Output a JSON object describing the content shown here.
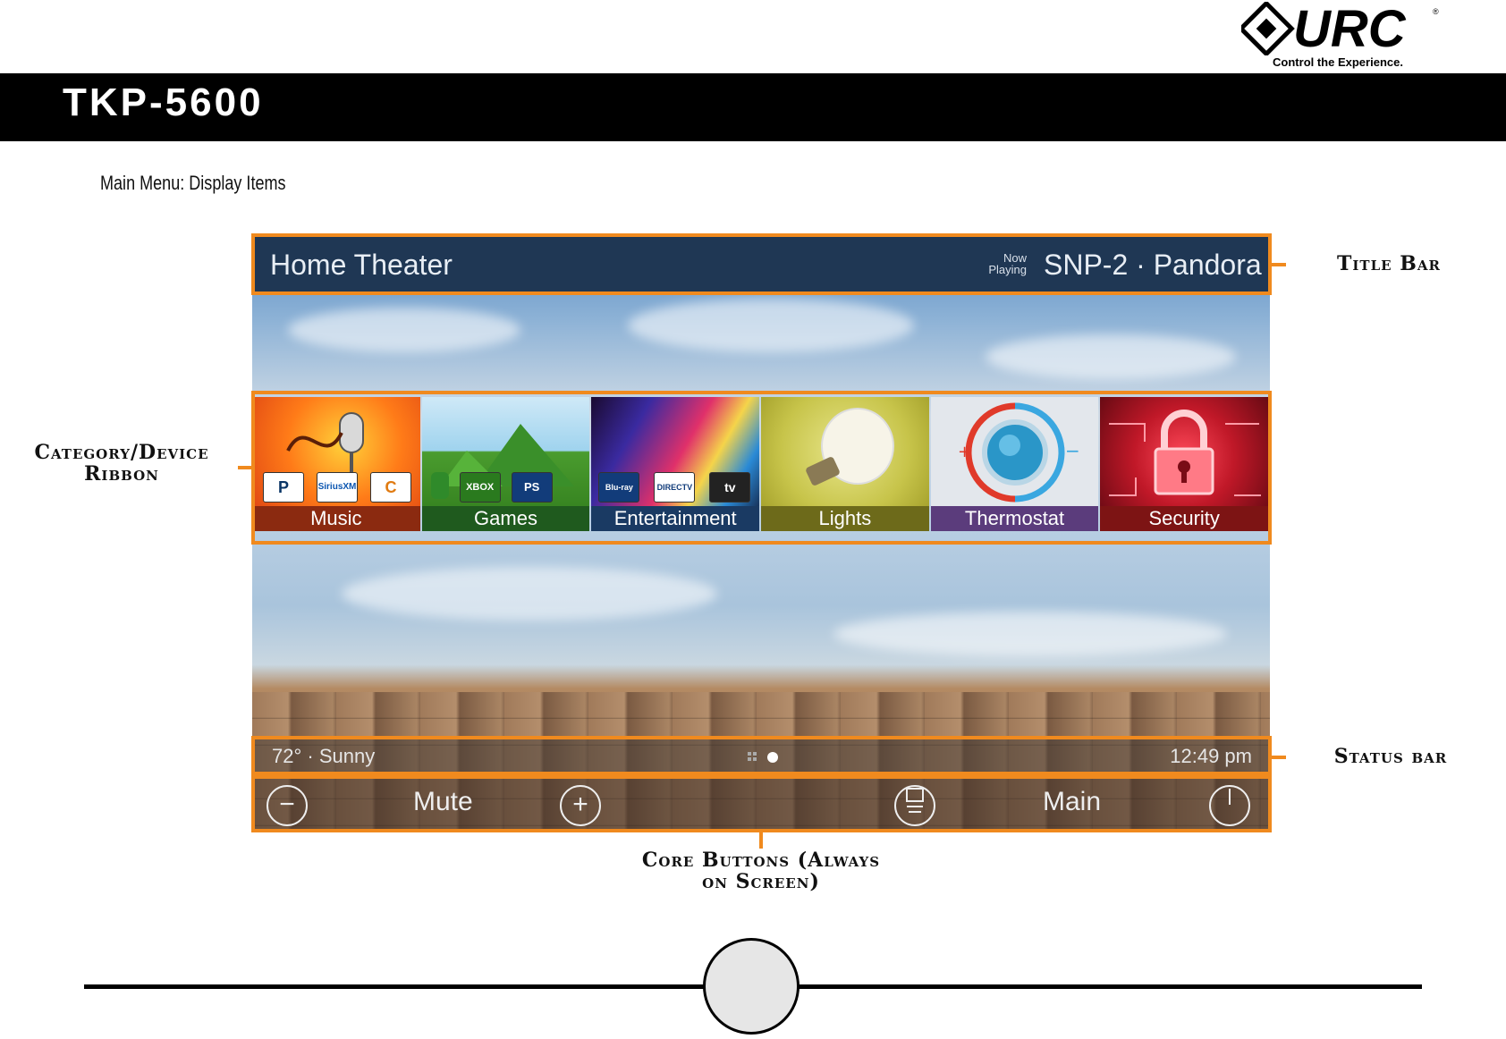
{
  "header": {
    "brand_tagline": "Control the Experience.",
    "doc_title": "TKP-5600",
    "subtitle": "Main Menu: Display Items"
  },
  "screen": {
    "title_bar": {
      "room": "Home Theater",
      "now_playing_label": "Now Playing",
      "source": "SNP-2 · Pandora"
    },
    "ribbon": [
      {
        "label": "Music",
        "color": "#8b2a10"
      },
      {
        "label": "Games",
        "color": "#1f5a1e"
      },
      {
        "label": "Entertainment",
        "color": "#1a3a63"
      },
      {
        "label": "Lights",
        "color": "#6d6a1a"
      },
      {
        "label": "Thermostat",
        "color": "#5b3c7c"
      },
      {
        "label": "Security",
        "color": "#7d1414"
      }
    ],
    "music_badges": [
      "P",
      "SiriusXM",
      "C"
    ],
    "games_badges": [
      "XBOX",
      "PS"
    ],
    "entertainment_badges": [
      "Blu-ray",
      "DIRECTV",
      "tv"
    ],
    "status_bar": {
      "weather": "72° · Sunny",
      "time": "12:49 pm"
    },
    "core_buttons": {
      "left_label": "Mute",
      "right_label": "Main"
    }
  },
  "callouts": {
    "title_bar": "Title Bar",
    "ribbon": "Category/Device Ribbon",
    "status_bar": "Status bar",
    "core_buttons": "Core Buttons (Always on Screen)"
  },
  "colors": {
    "accent": "#f08a1e",
    "title_bar": "#1f3754"
  }
}
